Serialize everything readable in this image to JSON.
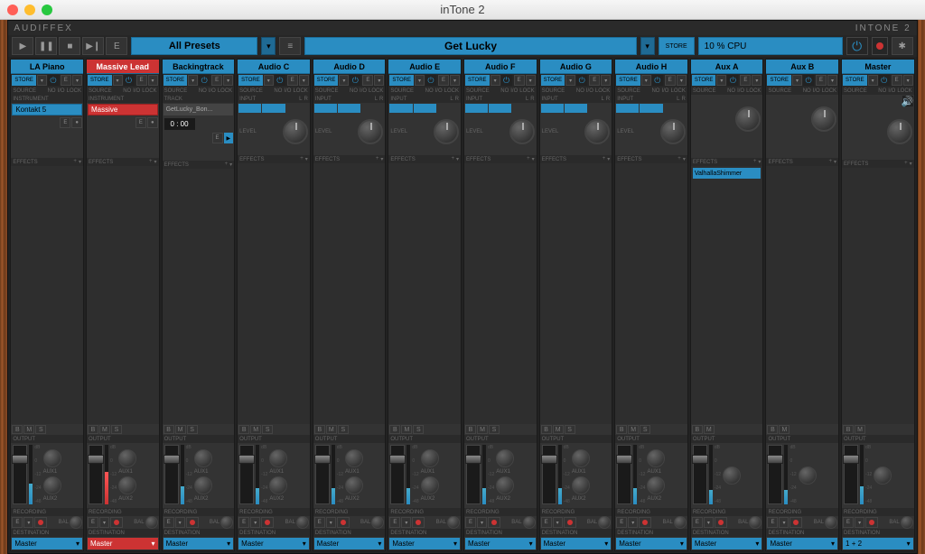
{
  "window": {
    "title": "inTone 2"
  },
  "brand": {
    "left": "AUDIFFEX",
    "right": "INTONE 2"
  },
  "transport": {
    "play": "▶",
    "pause": "❚❚",
    "stop": "■",
    "next": "▶❙",
    "e": "E"
  },
  "preset": {
    "label": "All Presets",
    "list_icon": "≡"
  },
  "song": {
    "label": "Get Lucky",
    "store": "STORE"
  },
  "cpu": {
    "label": "10 % CPU"
  },
  "power": {
    "icon": "⏻",
    "gear": "✱"
  },
  "labels": {
    "source": "SOURCE",
    "no": "NO",
    "io": "I/O",
    "lock": "LOCK",
    "instrument": "INSTRUMENT",
    "track": "TRACK",
    "input": "INPUT",
    "level": "LEVEL",
    "effects": "EFFECTS",
    "output": "OUTPUT",
    "recording": "RECORDING",
    "destination": "DESTINATION",
    "bal": "BAL",
    "aux1": "AUX1",
    "aux2": "AUX2",
    "store": "STORE",
    "e": "E",
    "dd": "▾",
    "plus": "+",
    "b": "B",
    "m": "M",
    "s": "S",
    "L": "L",
    "R": "R",
    "l_scale_top": "dB",
    "l_scale_0": "0"
  },
  "channels": [
    {
      "name": "LA Piano",
      "type": "inst",
      "hot": false,
      "inst": "Kontakt 5",
      "dest": "Master",
      "meter": 35
    },
    {
      "name": "Massive Lead",
      "type": "inst",
      "hot": true,
      "inst": "Massive",
      "dest": "Master",
      "meter": 55
    },
    {
      "name": "Backingtrack",
      "type": "track",
      "hot": false,
      "track": "GetLucky_Bon...",
      "time": "0 : 00",
      "dest": "Master",
      "meter": 30
    },
    {
      "name": "Audio C",
      "type": "audio",
      "hot": false,
      "dest": "Master",
      "meter": 28
    },
    {
      "name": "Audio D",
      "type": "audio",
      "hot": false,
      "dest": "Master",
      "meter": 28
    },
    {
      "name": "Audio E",
      "type": "audio",
      "hot": false,
      "dest": "Master",
      "meter": 28
    },
    {
      "name": "Audio F",
      "type": "audio",
      "hot": false,
      "dest": "Master",
      "meter": 28
    },
    {
      "name": "Audio G",
      "type": "audio",
      "hot": false,
      "dest": "Master",
      "meter": 28
    },
    {
      "name": "Audio H",
      "type": "audio",
      "hot": false,
      "dest": "Master",
      "meter": 28
    },
    {
      "name": "Aux A",
      "type": "aux",
      "hot": false,
      "fx": "ValhallaShimmer",
      "dest": "Master",
      "meter": 25
    },
    {
      "name": "Aux B",
      "type": "aux",
      "hot": false,
      "dest": "Master",
      "meter": 25
    },
    {
      "name": "Master",
      "type": "master",
      "hot": false,
      "dest": "1 + 2",
      "meter": 30
    }
  ]
}
